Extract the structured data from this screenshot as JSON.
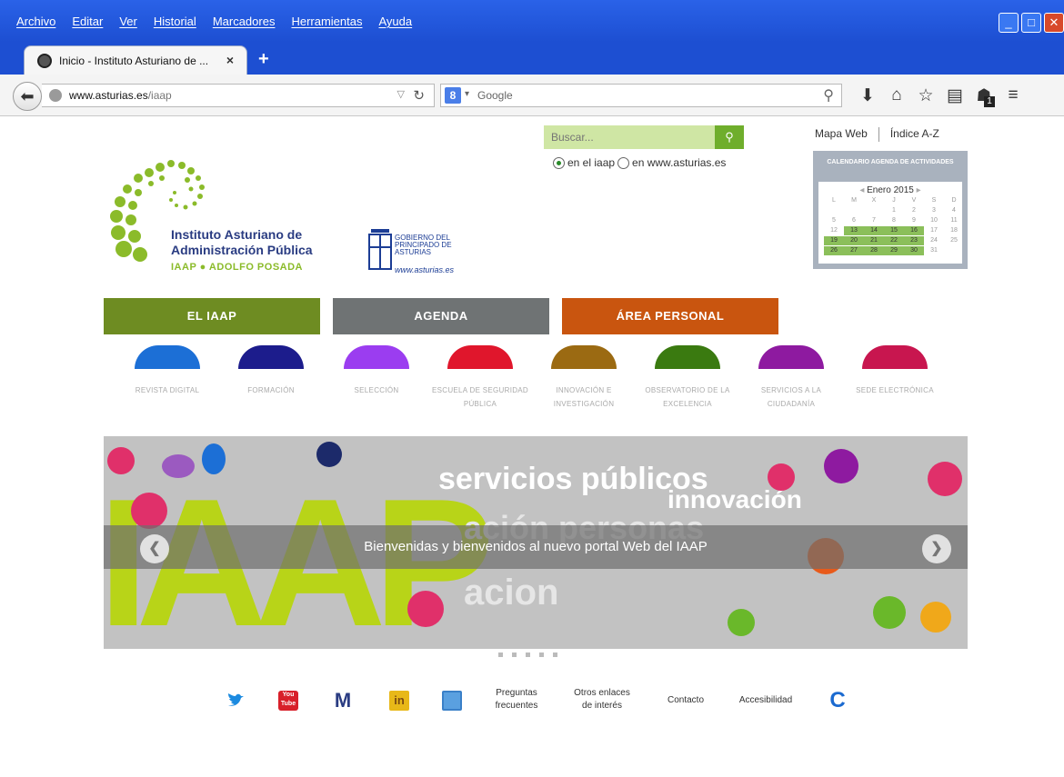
{
  "browser": {
    "menu": [
      "Archivo",
      "Editar",
      "Ver",
      "Historial",
      "Marcadores",
      "Herramientas",
      "Ayuda"
    ],
    "tab_title": "Inicio - Instituto Asturiano de ...",
    "tab_close": "×",
    "new_tab": "+",
    "url_domain": "www.asturias.es",
    "url_path": "/iaap",
    "search_engine": "Google",
    "search_engine_letter": "8",
    "notification_count": "1"
  },
  "header": {
    "logo_line1": "Instituto Asturiano de",
    "logo_line2": "Administración Pública",
    "logo_line3": "IAAP ● ADOLFO POSADA",
    "gob_line1": "GOBIERNO DEL",
    "gob_line2": "PRINCIPADO DE",
    "gob_line3": "ASTURIAS",
    "gob_web": "www.asturias.es",
    "search_placeholder": "Buscar...",
    "radio1": "en el iaap",
    "radio2": "en www.asturias.es",
    "link_mapa": "Mapa Web",
    "link_indice": "Índice A-Z"
  },
  "calendar": {
    "title": "CALENDARIO AGENDA DE ACTIVIDADES",
    "month": "Enero 2015",
    "prev": "◂",
    "next": "▸",
    "weekdays": [
      "L",
      "M",
      "X",
      "J",
      "V",
      "S",
      "D"
    ],
    "cells": [
      "",
      "",
      "",
      "1",
      "2",
      "3",
      "4",
      "5",
      "6",
      "7",
      "8",
      "9",
      "10",
      "11",
      "12",
      "13",
      "14",
      "15",
      "16",
      "17",
      "18",
      "19",
      "20",
      "21",
      "22",
      "23",
      "24",
      "25",
      "26",
      "27",
      "28",
      "29",
      "30",
      "31",
      ""
    ],
    "highlighted": [
      "13",
      "14",
      "15",
      "16",
      "19",
      "20",
      "21",
      "22",
      "23",
      "26",
      "27",
      "28",
      "29",
      "30"
    ]
  },
  "main_nav": [
    "EL IAAP",
    "AGENDA",
    "ÁREA PERSONAL"
  ],
  "sections": [
    {
      "label": "REVISTA DIGITAL",
      "color": "#1c6fd6"
    },
    {
      "label": "FORMACIÓN",
      "color": "#1c1c8c"
    },
    {
      "label": "SELECCIÓN",
      "color": "#9b3df0"
    },
    {
      "label": "ESCUELA DE SEGURIDAD PÚBLICA",
      "color": "#e0162c"
    },
    {
      "label": "INNOVACIÓN E INVESTIGACIÓN",
      "color": "#9b6a12"
    },
    {
      "label": "OBSERVATORIO DE LA EXCELENCIA",
      "color": "#3a7a10"
    },
    {
      "label": "SERVICIOS A LA CIUDADANÍA",
      "color": "#8e1aa0"
    },
    {
      "label": "SEDE ELECTRÓNICA",
      "color": "#c8164f"
    }
  ],
  "banner": {
    "caption": "Bienvenidas y bienvenidos al nuevo portal Web del IAAP",
    "big_letters": "IAAP",
    "word1": "servicios públicos",
    "word2": "innovación",
    "word3": "ación personas",
    "word4": "acion",
    "youtube": "You Tube"
  },
  "footer": {
    "preguntas_1": "Preguntas",
    "preguntas_2": "frecuentes",
    "otros_1": "Otros enlaces",
    "otros_2": "de interés",
    "contacto": "Contacto",
    "accesibilidad": "Accesibilidad",
    "youtube_label": "You Tube",
    "m_letter": "M",
    "in_letters": "in",
    "c_letter": "C"
  },
  "colors": {
    "browser_blue": "#1d4fd2",
    "iaap_green": "#8bbb2a",
    "nav_green": "#6e8c22",
    "nav_gray": "#6f7374",
    "nav_orange": "#c9550f",
    "iaap_blue": "#2a3c82"
  }
}
